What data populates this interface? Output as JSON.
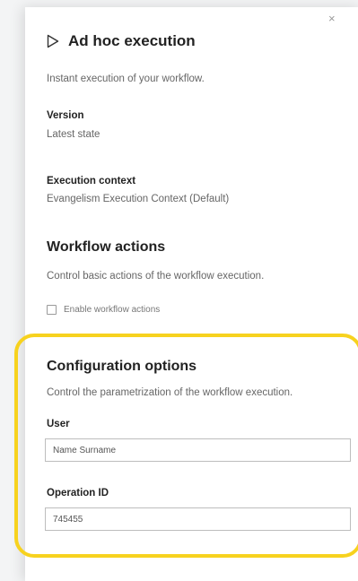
{
  "panel": {
    "close_glyph": "×",
    "title": "Ad hoc execution",
    "description": "Instant execution of your workflow."
  },
  "version": {
    "label": "Version",
    "value": "Latest state"
  },
  "execution_context": {
    "label": "Execution context",
    "value": "Evangelism Execution Context (Default)"
  },
  "workflow_actions": {
    "title": "Workflow actions",
    "description": "Control basic actions of the workflow execution.",
    "checkbox_label": "Enable workflow actions",
    "checked": false
  },
  "configuration_options": {
    "title": "Configuration options",
    "description": "Control the parametrization of the workflow execution.",
    "user_label": "User",
    "user_value": "Name Surname",
    "operation_id_label": "Operation ID",
    "operation_id_value": "745455"
  },
  "colors": {
    "highlight": "#f7d21e",
    "panel_bg": "#ffffff",
    "page_bg": "#f3f4f5"
  }
}
